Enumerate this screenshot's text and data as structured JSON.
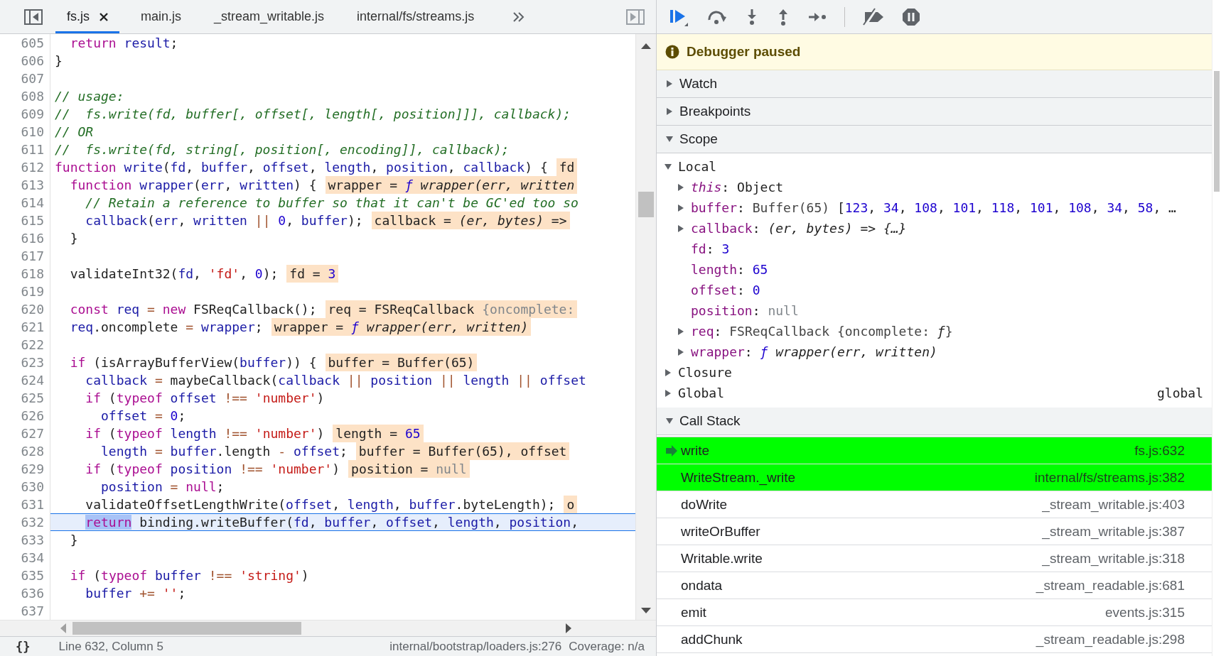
{
  "editor": {
    "tabs": [
      {
        "label": "fs.js",
        "selected": true,
        "closable": true
      },
      {
        "label": "main.js",
        "selected": false,
        "closable": false
      },
      {
        "label": "_stream_writable.js",
        "selected": false,
        "closable": false
      },
      {
        "label": "internal/fs/streams.js",
        "selected": false,
        "closable": false
      }
    ],
    "lines": [
      {
        "number": "605",
        "current": false,
        "tokens": [
          {
            "text": "  return",
            "kind": "kw"
          },
          {
            "text": " result",
            "kind": "var"
          },
          {
            "text": ";",
            "kind": "plain"
          }
        ]
      },
      {
        "number": "606",
        "current": false,
        "tokens": [
          {
            "text": "}",
            "kind": "plain"
          }
        ]
      },
      {
        "number": "607",
        "current": false
      },
      {
        "number": "608",
        "current": false,
        "tokens": [
          {
            "text": "// usage:",
            "kind": "com"
          }
        ]
      },
      {
        "number": "609",
        "current": false,
        "tokens": [
          {
            "text": "//  fs.write(fd, buffer[, offset[, length[, position]]], callback);",
            "kind": "com"
          }
        ]
      },
      {
        "number": "610",
        "current": false,
        "tokens": [
          {
            "text": "// OR",
            "kind": "com"
          }
        ]
      },
      {
        "number": "611",
        "current": false,
        "tokens": [
          {
            "text": "//  fs.write(fd, string[, position[, encoding]], callback);",
            "kind": "com"
          }
        ]
      },
      {
        "number": "612",
        "current": false,
        "tokens": [
          {
            "text": "function",
            "kind": "kw"
          },
          {
            "text": " write",
            "kind": "var"
          },
          {
            "text": "(",
            "kind": "plain"
          },
          {
            "text": "fd",
            "kind": "var"
          },
          {
            "text": ", ",
            "kind": "plain"
          },
          {
            "text": "buffer",
            "kind": "var"
          },
          {
            "text": ", ",
            "kind": "plain"
          },
          {
            "text": "offset",
            "kind": "var"
          },
          {
            "text": ", ",
            "kind": "plain"
          },
          {
            "text": "length",
            "kind": "var"
          },
          {
            "text": ", ",
            "kind": "plain"
          },
          {
            "text": "position",
            "kind": "var"
          },
          {
            "text": ", ",
            "kind": "plain"
          },
          {
            "text": "callback",
            "kind": "var"
          },
          {
            "text": ") {",
            "kind": "plain"
          }
        ],
        "annotation": [
          {
            "text": "fd",
            "kind": "plain"
          }
        ]
      },
      {
        "number": "613",
        "current": false,
        "tokens": [
          {
            "text": "  function",
            "kind": "kw"
          },
          {
            "text": " wrapper",
            "kind": "var"
          },
          {
            "text": "(",
            "kind": "plain"
          },
          {
            "text": "err",
            "kind": "var"
          },
          {
            "text": ", ",
            "kind": "plain"
          },
          {
            "text": "written",
            "kind": "var"
          },
          {
            "text": ") {",
            "kind": "plain"
          }
        ],
        "annotation": [
          {
            "text": "wrapper = ",
            "kind": "plain"
          },
          {
            "text": "ƒ",
            "kind": "fn"
          },
          {
            "text": " wrapper(err, written",
            "kind": "it"
          }
        ]
      },
      {
        "number": "614",
        "current": false,
        "tokens": [
          {
            "text": "    // Retain a reference to buffer so that it can't be GC'ed too so",
            "kind": "com"
          }
        ]
      },
      {
        "number": "615",
        "current": false,
        "tokens": [
          {
            "text": "    callback",
            "kind": "var"
          },
          {
            "text": "(",
            "kind": "plain"
          },
          {
            "text": "err",
            "kind": "var"
          },
          {
            "text": ", ",
            "kind": "plain"
          },
          {
            "text": "written",
            "kind": "var"
          },
          {
            "text": " ||",
            "kind": "op"
          },
          {
            "text": " 0",
            "kind": "num"
          },
          {
            "text": ", ",
            "kind": "plain"
          },
          {
            "text": "buffer",
            "kind": "var"
          },
          {
            "text": ");",
            "kind": "plain"
          }
        ],
        "annotation": [
          {
            "text": "callback = ",
            "kind": "plain"
          },
          {
            "text": "(er, bytes) =>",
            "kind": "it"
          }
        ]
      },
      {
        "number": "616",
        "current": false,
        "tokens": [
          {
            "text": "  }",
            "kind": "plain"
          }
        ]
      },
      {
        "number": "617",
        "current": false
      },
      {
        "number": "618",
        "current": false,
        "tokens": [
          {
            "text": "  validateInt32(",
            "kind": "plain"
          },
          {
            "text": "fd",
            "kind": "var"
          },
          {
            "text": ", ",
            "kind": "plain"
          },
          {
            "text": "'fd'",
            "kind": "str"
          },
          {
            "text": ", ",
            "kind": "plain"
          },
          {
            "text": "0",
            "kind": "num"
          },
          {
            "text": ");",
            "kind": "plain"
          }
        ],
        "annotation": [
          {
            "text": "fd = ",
            "kind": "plain"
          },
          {
            "text": "3",
            "kind": "num"
          }
        ]
      },
      {
        "number": "619",
        "current": false
      },
      {
        "number": "620",
        "current": false,
        "tokens": [
          {
            "text": "  const",
            "kind": "kw"
          },
          {
            "text": " req",
            "kind": "var"
          },
          {
            "text": " =",
            "kind": "op"
          },
          {
            "text": " new",
            "kind": "kw"
          },
          {
            "text": " FSReqCallback();",
            "kind": "plain"
          }
        ],
        "annotation": [
          {
            "text": "req = FSReqCallback ",
            "kind": "plain"
          },
          {
            "text": "{oncomplete:",
            "kind": "nul"
          }
        ]
      },
      {
        "number": "621",
        "current": false,
        "tokens": [
          {
            "text": "  req",
            "kind": "var"
          },
          {
            "text": ".oncomplete ",
            "kind": "plain"
          },
          {
            "text": "=",
            "kind": "op"
          },
          {
            "text": " wrapper",
            "kind": "var"
          },
          {
            "text": ";",
            "kind": "plain"
          }
        ],
        "annotation": [
          {
            "text": "wrapper = ",
            "kind": "plain"
          },
          {
            "text": "ƒ",
            "kind": "fn"
          },
          {
            "text": " wrapper(err, written)",
            "kind": "it"
          }
        ]
      },
      {
        "number": "622",
        "current": false
      },
      {
        "number": "623",
        "current": false,
        "tokens": [
          {
            "text": "  if",
            "kind": "kw"
          },
          {
            "text": " (isArrayBufferView(",
            "kind": "plain"
          },
          {
            "text": "buffer",
            "kind": "var"
          },
          {
            "text": ")) {",
            "kind": "plain"
          }
        ],
        "annotation": [
          {
            "text": "buffer = Buffer(65)",
            "kind": "plain"
          }
        ]
      },
      {
        "number": "624",
        "current": false,
        "tokens": [
          {
            "text": "    callback",
            "kind": "var"
          },
          {
            "text": " =",
            "kind": "op"
          },
          {
            "text": " maybeCallback(",
            "kind": "plain"
          },
          {
            "text": "callback",
            "kind": "var"
          },
          {
            "text": " ||",
            "kind": "op"
          },
          {
            "text": " position",
            "kind": "var"
          },
          {
            "text": " ||",
            "kind": "op"
          },
          {
            "text": " length",
            "kind": "var"
          },
          {
            "text": " ||",
            "kind": "op"
          },
          {
            "text": " offset",
            "kind": "var"
          }
        ]
      },
      {
        "number": "625",
        "current": false,
        "tokens": [
          {
            "text": "    if",
            "kind": "kw"
          },
          {
            "text": " (",
            "kind": "plain"
          },
          {
            "text": "typeof",
            "kind": "kw"
          },
          {
            "text": " offset",
            "kind": "var"
          },
          {
            "text": " !==",
            "kind": "op"
          },
          {
            "text": " 'number'",
            "kind": "str"
          },
          {
            "text": ")",
            "kind": "plain"
          }
        ]
      },
      {
        "number": "626",
        "current": false,
        "tokens": [
          {
            "text": "      offset",
            "kind": "var"
          },
          {
            "text": " =",
            "kind": "op"
          },
          {
            "text": " 0",
            "kind": "num"
          },
          {
            "text": ";",
            "kind": "plain"
          }
        ]
      },
      {
        "number": "627",
        "current": false,
        "tokens": [
          {
            "text": "    if",
            "kind": "kw"
          },
          {
            "text": " (",
            "kind": "plain"
          },
          {
            "text": "typeof",
            "kind": "kw"
          },
          {
            "text": " length",
            "kind": "var"
          },
          {
            "text": " !==",
            "kind": "op"
          },
          {
            "text": " 'number'",
            "kind": "str"
          },
          {
            "text": ")",
            "kind": "plain"
          }
        ],
        "annotation": [
          {
            "text": "length = ",
            "kind": "plain"
          },
          {
            "text": "65",
            "kind": "num"
          }
        ]
      },
      {
        "number": "628",
        "current": false,
        "tokens": [
          {
            "text": "      length",
            "kind": "var"
          },
          {
            "text": " =",
            "kind": "op"
          },
          {
            "text": " buffer",
            "kind": "var"
          },
          {
            "text": ".length ",
            "kind": "plain"
          },
          {
            "text": "-",
            "kind": "op"
          },
          {
            "text": " offset",
            "kind": "var"
          },
          {
            "text": ";",
            "kind": "plain"
          }
        ],
        "annotation": [
          {
            "text": "buffer = Buffer(65), offset",
            "kind": "plain"
          }
        ]
      },
      {
        "number": "629",
        "current": false,
        "tokens": [
          {
            "text": "    if",
            "kind": "kw"
          },
          {
            "text": " (",
            "kind": "plain"
          },
          {
            "text": "typeof",
            "kind": "kw"
          },
          {
            "text": " position",
            "kind": "var"
          },
          {
            "text": " !==",
            "kind": "op"
          },
          {
            "text": " 'number'",
            "kind": "str"
          },
          {
            "text": ")",
            "kind": "plain"
          }
        ],
        "annotation": [
          {
            "text": "position = ",
            "kind": "plain"
          },
          {
            "text": "null",
            "kind": "nul"
          }
        ]
      },
      {
        "number": "630",
        "current": false,
        "tokens": [
          {
            "text": "      position",
            "kind": "var"
          },
          {
            "text": " =",
            "kind": "op"
          },
          {
            "text": " null",
            "kind": "kw"
          },
          {
            "text": ";",
            "kind": "plain"
          }
        ]
      },
      {
        "number": "631",
        "current": false,
        "tokens": [
          {
            "text": "    validateOffsetLengthWrite(",
            "kind": "plain"
          },
          {
            "text": "offset",
            "kind": "var"
          },
          {
            "text": ", ",
            "kind": "plain"
          },
          {
            "text": "length",
            "kind": "var"
          },
          {
            "text": ", ",
            "kind": "plain"
          },
          {
            "text": "buffer",
            "kind": "var"
          },
          {
            "text": ".byteLength);",
            "kind": "plain"
          }
        ],
        "annotation": [
          {
            "text": "o",
            "kind": "plain"
          }
        ]
      },
      {
        "number": "632",
        "current": true,
        "tokens": [
          {
            "text": "    return",
            "kind": "exec"
          },
          {
            "text": " binding.writeBuffer(",
            "kind": "plain"
          },
          {
            "text": "fd",
            "kind": "var"
          },
          {
            "text": ", ",
            "kind": "plain"
          },
          {
            "text": "buffer",
            "kind": "var"
          },
          {
            "text": ", ",
            "kind": "plain"
          },
          {
            "text": "offset",
            "kind": "var"
          },
          {
            "text": ", ",
            "kind": "plain"
          },
          {
            "text": "length",
            "kind": "var"
          },
          {
            "text": ", ",
            "kind": "plain"
          },
          {
            "text": "position",
            "kind": "var"
          },
          {
            "text": ",",
            "kind": "plain"
          }
        ]
      },
      {
        "number": "633",
        "current": false,
        "tokens": [
          {
            "text": "  }",
            "kind": "plain"
          }
        ]
      },
      {
        "number": "634",
        "current": false
      },
      {
        "number": "635",
        "current": false,
        "tokens": [
          {
            "text": "  if",
            "kind": "kw"
          },
          {
            "text": " (",
            "kind": "plain"
          },
          {
            "text": "typeof",
            "kind": "kw"
          },
          {
            "text": " buffer",
            "kind": "var"
          },
          {
            "text": " !==",
            "kind": "op"
          },
          {
            "text": " 'string'",
            "kind": "str"
          },
          {
            "text": ")",
            "kind": "plain"
          }
        ]
      },
      {
        "number": "636",
        "current": false,
        "tokens": [
          {
            "text": "    buffer",
            "kind": "var"
          },
          {
            "text": " +=",
            "kind": "op"
          },
          {
            "text": " ''",
            "kind": "str"
          },
          {
            "text": ";",
            "kind": "plain"
          }
        ]
      },
      {
        "number": "637",
        "current": false
      }
    ],
    "status_bar": {
      "format_button": "{}",
      "cursor": "Line 632, Column 5",
      "source": "internal/bootstrap/loaders.js:276",
      "coverage": "Coverage: n/a"
    }
  },
  "debugger": {
    "banner": "Debugger paused",
    "sections": [
      {
        "title": "Watch",
        "expanded": false
      },
      {
        "title": "Breakpoints",
        "expanded": false
      },
      {
        "title": "Scope",
        "expanded": true,
        "scopes": [
          {
            "name": "Local",
            "expanded": true,
            "items": [
              {
                "name": "this",
                "kind": "receiver",
                "expandable": true,
                "expanded": false,
                "value": [
                  {
                    "text": ": ",
                    "kind": "plain"
                  },
                  {
                    "text": "Object",
                    "kind": "plain"
                  }
                ]
              },
              {
                "name": "buffer",
                "kind": "property",
                "expandable": true,
                "expanded": false,
                "value": [
                  {
                    "text": ": ",
                    "kind": "plain"
                  },
                  {
                    "text": "Buffer(65) ",
                    "kind": "dim"
                  },
                  {
                    "text": "[",
                    "kind": "plain"
                  },
                  {
                    "text": "123",
                    "kind": "num"
                  },
                  {
                    "text": ", ",
                    "kind": "plain"
                  },
                  {
                    "text": "34",
                    "kind": "num"
                  },
                  {
                    "text": ", ",
                    "kind": "plain"
                  },
                  {
                    "text": "108",
                    "kind": "num"
                  },
                  {
                    "text": ", ",
                    "kind": "plain"
                  },
                  {
                    "text": "101",
                    "kind": "num"
                  },
                  {
                    "text": ", ",
                    "kind": "plain"
                  },
                  {
                    "text": "118",
                    "kind": "num"
                  },
                  {
                    "text": ", ",
                    "kind": "plain"
                  },
                  {
                    "text": "101",
                    "kind": "num"
                  },
                  {
                    "text": ", ",
                    "kind": "plain"
                  },
                  {
                    "text": "108",
                    "kind": "num"
                  },
                  {
                    "text": ", ",
                    "kind": "plain"
                  },
                  {
                    "text": "34",
                    "kind": "num"
                  },
                  {
                    "text": ", ",
                    "kind": "plain"
                  },
                  {
                    "text": "58",
                    "kind": "num"
                  },
                  {
                    "text": ", …",
                    "kind": "plain"
                  }
                ]
              },
              {
                "name": "callback",
                "kind": "property",
                "expandable": true,
                "expanded": false,
                "value": [
                  {
                    "text": ": ",
                    "kind": "plain"
                  },
                  {
                    "text": "(er, bytes) => {…}",
                    "kind": "it"
                  }
                ]
              },
              {
                "name": "fd",
                "kind": "property",
                "expandable": false,
                "value": [
                  {
                    "text": ": ",
                    "kind": "plain"
                  },
                  {
                    "text": "3",
                    "kind": "num"
                  }
                ]
              },
              {
                "name": "length",
                "kind": "property",
                "expandable": false,
                "value": [
                  {
                    "text": ": ",
                    "kind": "plain"
                  },
                  {
                    "text": "65",
                    "kind": "num"
                  }
                ]
              },
              {
                "name": "offset",
                "kind": "property",
                "expandable": false,
                "value": [
                  {
                    "text": ": ",
                    "kind": "plain"
                  },
                  {
                    "text": "0",
                    "kind": "num"
                  }
                ]
              },
              {
                "name": "position",
                "kind": "property",
                "expandable": false,
                "value": [
                  {
                    "text": ": ",
                    "kind": "plain"
                  },
                  {
                    "text": "null",
                    "kind": "nul"
                  }
                ]
              },
              {
                "name": "req",
                "kind": "property",
                "expandable": true,
                "expanded": false,
                "value": [
                  {
                    "text": ": ",
                    "kind": "plain"
                  },
                  {
                    "text": "FSReqCallback {oncomplete: ",
                    "kind": "dim"
                  },
                  {
                    "text": "ƒ",
                    "kind": "it"
                  },
                  {
                    "text": "}",
                    "kind": "dim"
                  }
                ]
              },
              {
                "name": "wrapper",
                "kind": "property",
                "expandable": true,
                "expanded": false,
                "value": [
                  {
                    "text": ": ",
                    "kind": "plain"
                  },
                  {
                    "text": "ƒ",
                    "kind": "fn"
                  },
                  {
                    "text": " wrapper(err, written)",
                    "kind": "it"
                  }
                ]
              }
            ]
          },
          {
            "name": "Closure",
            "expanded": false
          },
          {
            "name": "Global",
            "expanded": false,
            "value": "global"
          }
        ]
      },
      {
        "title": "Call Stack",
        "expanded": true,
        "frames": [
          {
            "function": "write",
            "location": "fs.js:632",
            "highlighted": true,
            "current": true
          },
          {
            "function": "WriteStream._write",
            "location": "internal/fs/streams.js:382",
            "highlighted": true,
            "current": false
          },
          {
            "function": "doWrite",
            "location": "_stream_writable.js:403",
            "highlighted": false,
            "current": false
          },
          {
            "function": "writeOrBuffer",
            "location": "_stream_writable.js:387",
            "highlighted": false,
            "current": false
          },
          {
            "function": "Writable.write",
            "location": "_stream_writable.js:318",
            "highlighted": false,
            "current": false
          },
          {
            "function": "ondata",
            "location": "_stream_readable.js:681",
            "highlighted": false,
            "current": false
          },
          {
            "function": "emit",
            "location": "events.js:315",
            "highlighted": false,
            "current": false
          },
          {
            "function": "addChunk",
            "location": "_stream_readable.js:298",
            "highlighted": false,
            "current": false
          }
        ]
      }
    ]
  }
}
